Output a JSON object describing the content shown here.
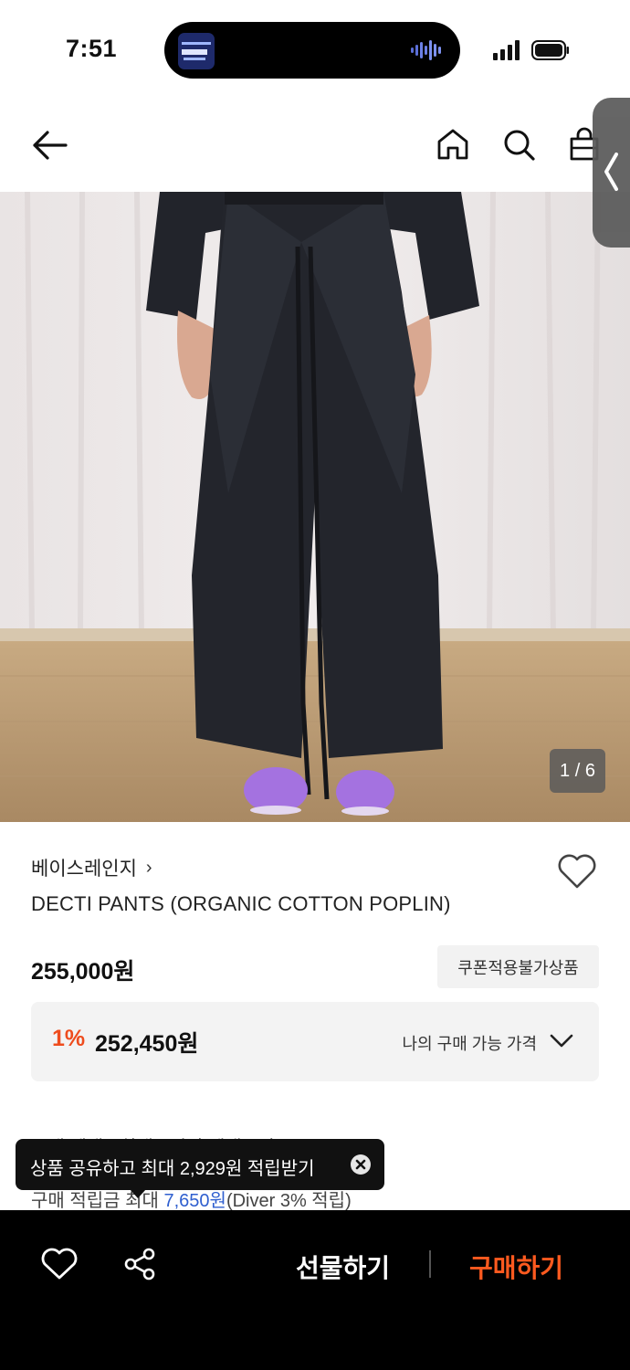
{
  "status_bar": {
    "time": "7:51"
  },
  "icons": {
    "back": "arrow-left-icon",
    "home": "home-icon",
    "search": "search-icon",
    "bag": "shopping-bag-icon",
    "side_handle": "chevron-left-icon",
    "like": "heart-outline-icon",
    "dropdown": "chevron-down-icon",
    "close": "close-circle-icon",
    "share": "share-icon"
  },
  "gallery": {
    "counter": "1 / 6"
  },
  "product": {
    "brand": "베이스레인지",
    "brand_chevron": "›",
    "name": "DECTI PANTS (ORGANIC COTTON POPLIN)",
    "price": "255,000원",
    "coupon_badge": "쿠폰적용불가상품"
  },
  "my_price": {
    "discount": "1%",
    "price": "252,450원",
    "label": "나의 구매 가능 가격"
  },
  "info": {
    "line1": "구매 혜택 · 최대 · 적립 혜택 · 의류",
    "line2_prefix": "구매 적립금   최대 ",
    "line2_amount": "7,650원",
    "line2_suffix": "(Diver 3% 적립)"
  },
  "tooltip": {
    "text": "상품 공유하고 최대 2,929원 적립받기"
  },
  "bottom_bar": {
    "gift_label": "선물하기",
    "buy_label": "구매하기"
  },
  "colors": {
    "accent_orange": "#ff5a1f",
    "discount_red": "#ee4c1d",
    "link_blue": "#2f5fcf",
    "bottom_bar_bg": "#000000"
  }
}
